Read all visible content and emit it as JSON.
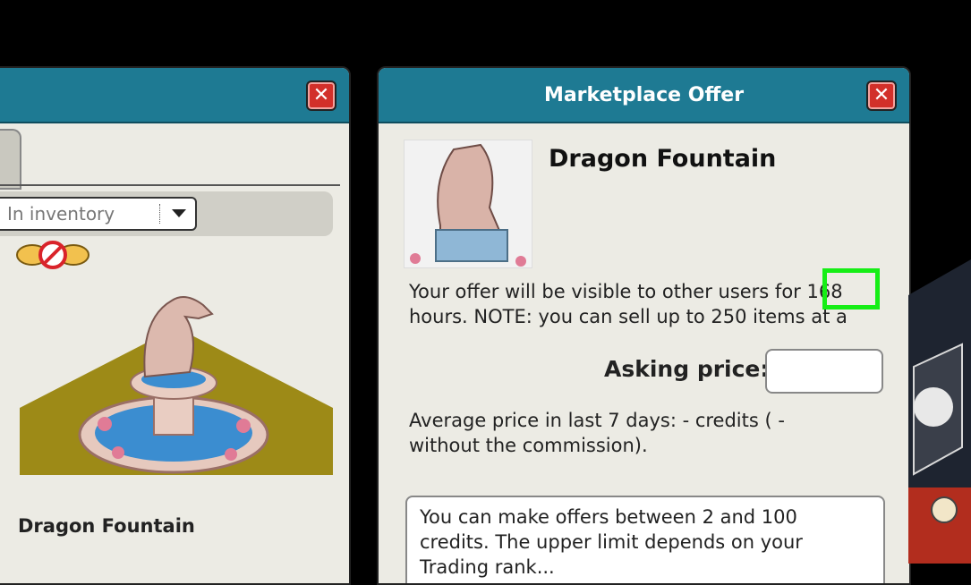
{
  "left_window": {
    "close_label": "✕",
    "filter_value": "In inventory",
    "item_name": "Dragon Fountain"
  },
  "offer_window": {
    "title": "Marketplace Offer",
    "close_label": "✕",
    "item_name": "Dragon Fountain",
    "visibility_text_before": "Your offer will be visible to other users for",
    "visibility_hours": "168",
    "visibility_text_after": "hours. NOTE: you can sell up to 250 items at a",
    "asking_price_label": "Asking price:",
    "asking_price_value": "",
    "average_line1": "Average price in last 7 days:  -  credits ( -",
    "average_line2": "without the commission).",
    "info_line1": "You can make offers between 2 and 100",
    "info_line2": "credits. The upper limit depends on your",
    "info_line3": "Trading rank...",
    "colors": {
      "titlebar": "#1e7a93",
      "close": "#d2302a",
      "highlight": "#16ee16"
    }
  }
}
